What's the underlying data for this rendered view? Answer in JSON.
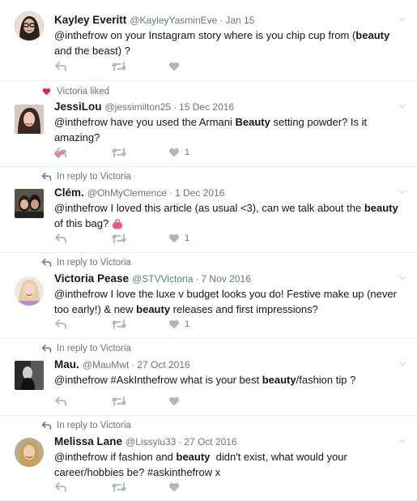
{
  "colors": {
    "muted": "#657786",
    "icon": "#aab8c2",
    "liked": "#e0245e",
    "divider": "#e6ecf0"
  },
  "tweets": [
    {
      "context": "",
      "name": "Kayley Everitt",
      "handle": "@KayleyYasminEve",
      "date": "Jan 15",
      "text_parts": [
        "@inthefrow on your Instagram story where is you chip cup from (",
        "beauty",
        " and the beast) ?"
      ],
      "like_count": ""
    },
    {
      "context": "Victoria liked",
      "context_icon": "heart-icon",
      "name": "JessiLou",
      "handle": "@jessimilton25",
      "date": "15 Dec 2016",
      "text_parts": [
        "@inthefrow have you used the Armani ",
        "Beauty",
        " setting powder? Is it amazing?"
      ],
      "emoji": "two-hearts-emoji",
      "like_count": "1"
    },
    {
      "context": "In reply to Victoria",
      "context_icon": "reply-icon",
      "name": "Clém.",
      "handle": "@OhMyClemence",
      "date": "1 Dec 2016",
      "text_parts": [
        "@inthefrow I loved this article (as usual <3), can we talk about the ",
        "beauty",
        " of this bag?"
      ],
      "emoji": "handbag-emoji",
      "like_count": "1"
    },
    {
      "context": "In reply to Victoria",
      "context_icon": "reply-icon",
      "name": "Victoria Pease",
      "handle": "@STVVictoria",
      "date": "7 Nov 2016",
      "text_parts": [
        "@inthefrow I love the luxe v budget looks you do! Festive make up (never too early!) & new ",
        "beauty",
        " releases and first impressions?"
      ],
      "like_count": "1"
    },
    {
      "context": "In reply to Victoria",
      "context_icon": "reply-icon",
      "name": "Mau.",
      "handle": "@MauMwt",
      "date": "27 Oct 2016",
      "text_parts": [
        "@inthefrow #AskInthefrow what is your best ",
        "beauty",
        "/fashion tip ?"
      ],
      "like_count": ""
    },
    {
      "context": "In reply to Victoria",
      "context_icon": "reply-icon",
      "name": "Melissa Lane",
      "handle": "@Lissylu33",
      "date": "27 Oct 2016",
      "text_parts": [
        "@inthefrow if fashion and ",
        "beauty",
        "  didn't exist, what would your career/hobbies be? #askinthefrow x"
      ],
      "like_count": ""
    }
  ]
}
